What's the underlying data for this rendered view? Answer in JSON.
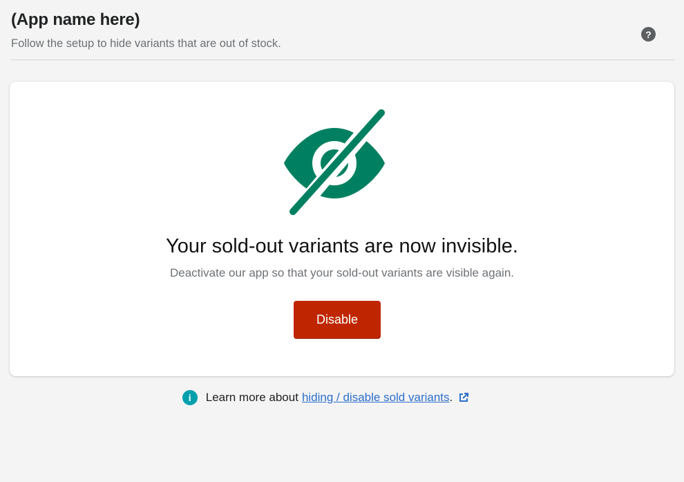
{
  "header": {
    "title": "(App name here)",
    "subtitle": "Follow the setup to hide variants that are out of stock.",
    "help_icon": "?"
  },
  "card": {
    "icon": "eye-slash-icon",
    "icon_color": "#008060",
    "heading": "Your sold-out variants are now invisible.",
    "body": "Deactivate our app so that your sold-out variants are visible again.",
    "button_label": "Disable",
    "button_color": "#bf2600"
  },
  "footer": {
    "info_icon": "i",
    "prefix": "Learn more about",
    "link_text": "hiding / disable sold variants",
    "suffix": ".",
    "external_icon": "external-link-icon",
    "link_color": "#2c6ecb"
  }
}
